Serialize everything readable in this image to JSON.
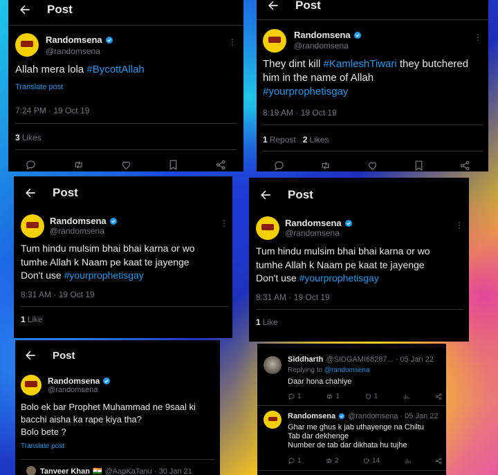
{
  "posts": [
    {
      "header_title": "Post",
      "display_name": "Randomsena",
      "handle": "@randomsena",
      "text_lines": [
        "Allah mera lola "
      ],
      "hashtag": "#BycottAllah",
      "translate": "Translate post",
      "timestamp": "7:24 PM · 19 Oct 19",
      "likes_count": "3",
      "likes_label": "Likes"
    },
    {
      "header_title": "Post",
      "display_name": "Randomsena",
      "handle": "@randomsena",
      "text_pre": "They dint kill ",
      "hashtag1": "#KamleshTiwari",
      "text_mid": " they butchered him in the name of Allah",
      "hashtag2": "#yourprophetisgay",
      "timestamp": "8:19 AM · 19 Oct 19",
      "reposts_count": "1",
      "reposts_label": "Repost",
      "likes_count": "2",
      "likes_label": "Likes"
    },
    {
      "header_title": "Post",
      "display_name": "Randomsena",
      "handle": "@randomsena",
      "line1": "Tum hindu mulsim bhai bhai karna or wo",
      "line2": "tumhe Allah k Naam pe kaat te jayenge",
      "line3": "Don't use ",
      "hashtag": "#yourprophetisgay",
      "timestamp": "8:31 AM · 19 Oct 19",
      "likes_count": "1",
      "likes_label": "Like"
    },
    {
      "header_title": "Post",
      "display_name": "Randomsena",
      "handle": "@randomsena",
      "line1": "Tum hindu mulsim bhai bhai karna or wo",
      "line2": "tumhe Allah k Naam pe kaat te jayenge",
      "line3": "Don't use ",
      "hashtag": "#yourprophetisgay",
      "timestamp": "8:31 AM · 19 Oct 19",
      "likes_count": "1",
      "likes_label": "Like"
    },
    {
      "header_title": "Post",
      "display_name": "Randomsena",
      "handle": "@randomsena",
      "line1": "Bolo ek bar Prophet Muhammad ne 9saal ki",
      "line2": "bacchi aisha ka rape kiya tha?",
      "line3": "Bolo bete ?",
      "translate": "Translate post",
      "next_name": "Tanveer Khan",
      "next_handle": "@AapKaTanu · 30 Jan 21"
    }
  ],
  "replies": {
    "reply1": {
      "name": "Siddharth",
      "meta": "@SIDGAMI68287... · 05 Jan 22",
      "replying_prefix": "Replying to ",
      "replying_handle": "@randomsena",
      "text": "Daar hona chahiye",
      "replies": "1",
      "reposts": "1",
      "likes": "1"
    },
    "reply2": {
      "name": "Randomsena",
      "meta": "@randomsena · 05 Jan 22",
      "line1": "Ghar me ghus k jab uthayenge na Chiltu",
      "line2": "Tab dar dekhenge",
      "line3": "Number de tab dar dikhata hu tujhe",
      "replies": "1",
      "reposts": "2",
      "likes": "14"
    }
  },
  "colors": {
    "accent": "#1d9bf0",
    "muted": "#71767b",
    "text": "#e7e9ea",
    "avatar": "#f5d000"
  }
}
